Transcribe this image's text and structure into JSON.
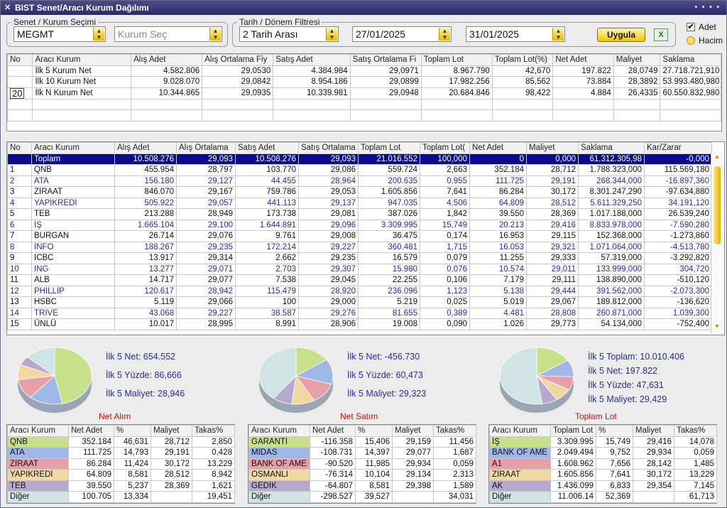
{
  "window": {
    "title": "BIST Senet/Aracı Kurum Dağılımı",
    "close": "✕",
    "controls": "• • • •"
  },
  "filters": {
    "stock_group_label": "Senet / Kurum Seçimi",
    "stock_value": "MEGMT",
    "broker_placeholder": "Kurum Seç",
    "date_group_label": "Tarih / Dönem Filtresi",
    "period_value": "2 Tarih Arası",
    "start_date": "27/01/2025",
    "end_date": "31/01/2025",
    "apply_label": "Uygula",
    "export_icon": "excel-icon",
    "adet_label": "Adet",
    "adet_checked": true,
    "hacim_label": "Hacim",
    "checkmark": "✔"
  },
  "top_table": {
    "headers": [
      "No",
      "Aracı Kurum",
      "Alış Adet",
      "Alış Ortalama Fiy",
      "Satış Adet",
      "Satış Ortalama Fi",
      "Toplam Lot",
      "Toplam Lot(%)",
      "Net Adet",
      "Maliyet",
      "Saklama"
    ],
    "n_value": "20",
    "rows": [
      [
        "",
        "İlk 5 Kurum Net",
        "4.582.806",
        "29,0530",
        "4.384.984",
        "29,0971",
        "8.967.790",
        "42,670",
        "197.822",
        "28,0749",
        "27.718.721,910"
      ],
      [
        "",
        "İlk 10 Kurum Net",
        "9.028.070",
        "29,0842",
        "8.954.186",
        "29,0899",
        "17.982.256",
        "85,562",
        "73.884",
        "28,3892",
        "53.993.480,980"
      ],
      [
        "",
        "İlk N Kurum Net",
        "10.344.865",
        "29,0935",
        "10.339.981",
        "29,0948",
        "20.684.846",
        "98,422",
        "4.884",
        "26,4335",
        "60.550.832,980"
      ]
    ]
  },
  "main_table": {
    "headers": [
      "No",
      "Aracı Kurum",
      "Alış Adet",
      "Alış Ortalama",
      "Satış Adet",
      "Satış Ortalama",
      "Toplam Lot",
      "Toplam Lot(",
      "Net Adet",
      "Maliyet",
      "Saklama",
      "Kar/Zarar"
    ],
    "total": [
      "",
      "Toplam",
      "10.508.276",
      "29,093",
      "10.508.276",
      "29,093",
      "21.016.552",
      "100,000",
      "0",
      "0,000",
      "61.312.305,98",
      "-0,000"
    ],
    "rows": [
      [
        "1",
        "QNB",
        "455.954",
        "28,797",
        "103.770",
        "29,086",
        "559.724",
        "2,663",
        "352.184",
        "28,712",
        "1.788.323,000",
        "115.569,180"
      ],
      [
        "2",
        "ATA",
        "156.180",
        "29,127",
        "44.455",
        "28,964",
        "200.635",
        "0,955",
        "111.725",
        "29,191",
        "268.344,000",
        "-16.897,360"
      ],
      [
        "3",
        "ZİRAAT",
        "846.070",
        "29,167",
        "759.786",
        "29,053",
        "1.605.856",
        "7,641",
        "86.284",
        "30,172",
        "8.301.247,290",
        "-97.634,880"
      ],
      [
        "4",
        "YAPIKREDİ",
        "505.922",
        "29,057",
        "441.113",
        "29,137",
        "947.035",
        "4,506",
        "64.809",
        "28,512",
        "5.611.329,250",
        "34.191,120"
      ],
      [
        "5",
        "TEB",
        "213.288",
        "28,949",
        "173.738",
        "29,081",
        "387.026",
        "1,842",
        "39.550",
        "28,369",
        "1.017.188,000",
        "26.539,240"
      ],
      [
        "6",
        "İŞ",
        "1.665.104",
        "29,100",
        "1.644.891",
        "29,096",
        "3.309.995",
        "15,749",
        "20.213",
        "29,416",
        "8.833.978,000",
        "-7.590,280"
      ],
      [
        "7",
        "BURGAN",
        "26.714",
        "29,076",
        "9.761",
        "29,008",
        "36.475",
        "0,174",
        "16.953",
        "29,115",
        "152.368,000",
        "-1.273,860"
      ],
      [
        "8",
        "İNFO",
        "188.267",
        "29,235",
        "172.214",
        "29,227",
        "360.481",
        "1,715",
        "16.053",
        "29,321",
        "1.071.064,000",
        "-4.513,780"
      ],
      [
        "9",
        "ICBC",
        "13.917",
        "29,314",
        "2.662",
        "29,235",
        "16.579",
        "0,079",
        "11.255",
        "29,333",
        "57.319,000",
        "-3.292,820"
      ],
      [
        "10",
        "ING",
        "13.277",
        "29,071",
        "2.703",
        "29,307",
        "15.980",
        "0,076",
        "10.574",
        "29,011",
        "133.999,000",
        "304,720"
      ],
      [
        "11",
        "ALB",
        "14.717",
        "29,077",
        "7.538",
        "29,045",
        "22.255",
        "0,106",
        "7.179",
        "29,111",
        "138.890,000",
        "-510,120"
      ],
      [
        "12",
        "PHİLLİP",
        "120.617",
        "28,942",
        "115.479",
        "28,920",
        "236.096",
        "1,123",
        "5.138",
        "29,444",
        "391.562,000",
        "-2.073,300"
      ],
      [
        "13",
        "HSBC",
        "5.119",
        "29,066",
        "100",
        "29,000",
        "5.219",
        "0,025",
        "5.019",
        "29,067",
        "189.812,000",
        "-136,620"
      ],
      [
        "14",
        "TRIVE",
        "43.068",
        "29,227",
        "38.587",
        "29,276",
        "81.655",
        "0,389",
        "4.481",
        "28,808",
        "260.871,000",
        "1.039,300"
      ],
      [
        "15",
        "ÜNLÜ",
        "10.017",
        "28,995",
        "8.991",
        "28,906",
        "19.008",
        "0,090",
        "1.026",
        "29,773",
        "54.134,000",
        "-752,400"
      ]
    ]
  },
  "panels": [
    {
      "title": "Net Alım",
      "stats": [
        "İlk 5 Net: 654.552",
        "İlk 5 Yüzde: 86,666",
        "İlk 5 Maliyet: 28,946"
      ],
      "slices": [
        46.631,
        14.793,
        11.424,
        8.581,
        5.237,
        13.334
      ],
      "headers": [
        "Aracı Kurum",
        "Net Adet",
        "%",
        "Maliyet",
        "Takas%"
      ],
      "rows": [
        [
          "QNB",
          "352.184",
          "46,631",
          "28,712",
          "2,850"
        ],
        [
          "ATA",
          "111.725",
          "14,793",
          "29,191",
          "0,428"
        ],
        [
          "ZİRAAT",
          "86.284",
          "11,424",
          "30,172",
          "13,229"
        ],
        [
          "YAPIKREDİ",
          "64.809",
          "8,581",
          "28,512",
          "8,942"
        ],
        [
          "TEB",
          "39.550",
          "5,237",
          "28,369",
          "1,621"
        ],
        [
          "Diğer",
          "100.705",
          "13,334",
          "",
          "19,451"
        ]
      ]
    },
    {
      "title": "Net Satım",
      "stats": [
        "İlk 5 Net: -456.730",
        "İlk 5 Yüzde: 60,473",
        "İlk 5 Maliyet: 29,323"
      ],
      "slices": [
        15.406,
        14.397,
        11.985,
        10.104,
        8.581,
        39.527
      ],
      "headers": [
        "Aracı Kurum",
        "Net Adet",
        "%",
        "Maliyet",
        "Takas%"
      ],
      "rows": [
        [
          "GARANTİ",
          "-116.358",
          "15,406",
          "29,159",
          "11,456"
        ],
        [
          "MİDAS",
          "-108.731",
          "14,397",
          "29,077",
          "1,687"
        ],
        [
          "BANK OF AME",
          "-90.520",
          "11,985",
          "29,934",
          "0,059"
        ],
        [
          "OSMANLI",
          "-76.314",
          "10,104",
          "29,134",
          "2,313"
        ],
        [
          "GEDİK",
          "-64.807",
          "8,581",
          "29,398",
          "1,589"
        ],
        [
          "Diğer",
          "-298.527",
          "39,527",
          "",
          "34,031"
        ]
      ]
    },
    {
      "title": "Toplam Lot",
      "stats": [
        "İlk 5 Toplam: 10.010.406",
        "İlk 5 Net: 197.822",
        "İlk 5 Yüzde: 47,631",
        "İlk 5 Maliyet: 29,429"
      ],
      "slices": [
        15.749,
        9.752,
        7.656,
        7.641,
        6.833,
        52.369
      ],
      "headers": [
        "Aracı Kurum",
        "Toplam Lot",
        "%",
        "Maliyet",
        "Takas%"
      ],
      "rows": [
        [
          "İŞ",
          "3.309.995",
          "15,749",
          "29,416",
          "14,078"
        ],
        [
          "BANK OF AME",
          "2.049.494",
          "9,752",
          "29,934",
          "0,059"
        ],
        [
          "A1",
          "1.608.962",
          "7,656",
          "28,142",
          "1,485"
        ],
        [
          "ZİRAAT",
          "1.605.856",
          "7,641",
          "30,172",
          "13,229"
        ],
        [
          "AK",
          "1.436.099",
          "6,833",
          "29,354",
          "7,145"
        ],
        [
          "Diğer",
          "11.006.14",
          "52,369",
          "",
          "61,713"
        ]
      ]
    }
  ],
  "slice_colors": [
    "#c9e08a",
    "#9fb8e8",
    "#e8a0a8",
    "#f0d8a0",
    "#b8a8d0",
    "#d0e4e4"
  ]
}
